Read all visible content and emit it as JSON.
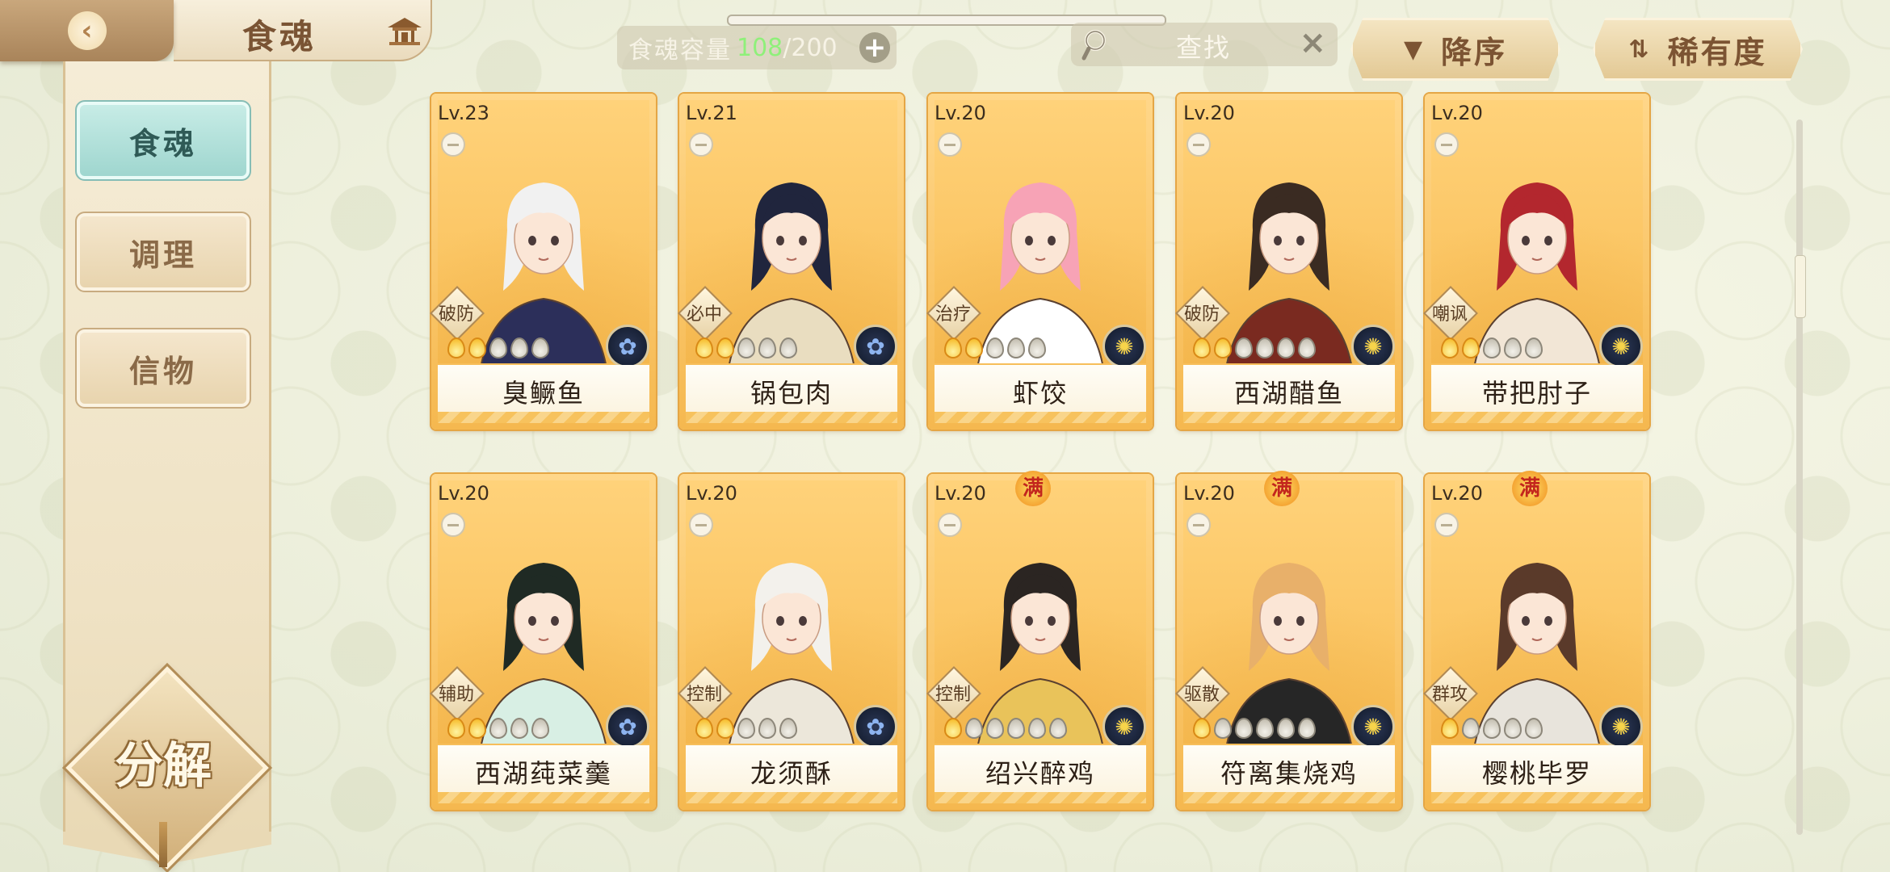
{
  "header": {
    "back_icon": "chevron-left-icon",
    "title": "食魂",
    "home_icon": "pavilion-icon"
  },
  "capacity": {
    "label": "食魂容量",
    "current": "108",
    "max": "200"
  },
  "search": {
    "placeholder": "查找",
    "clear": "×"
  },
  "sort": {
    "order_label": "降序",
    "rarity_label": "稀有度"
  },
  "sidebar": {
    "items": [
      {
        "label": "食魂",
        "active": true
      },
      {
        "label": "调理",
        "active": false
      },
      {
        "label": "信物",
        "active": false
      }
    ],
    "decompose_label": "分解"
  },
  "cards": [
    {
      "level": "Lv.23",
      "role": "破防",
      "name": "臭鳜鱼",
      "stars_on": 2,
      "stars_total": 5,
      "element": "flower",
      "full": ""
    },
    {
      "level": "Lv.21",
      "role": "必中",
      "name": "锅包肉",
      "stars_on": 2,
      "stars_total": 5,
      "element": "flower",
      "full": ""
    },
    {
      "level": "Lv.20",
      "role": "治疗",
      "name": "虾饺",
      "stars_on": 2,
      "stars_total": 5,
      "element": "sun",
      "full": ""
    },
    {
      "level": "Lv.20",
      "role": "破防",
      "name": "西湖醋鱼",
      "stars_on": 2,
      "stars_total": 6,
      "element": "sun",
      "full": ""
    },
    {
      "level": "Lv.20",
      "role": "嘲讽",
      "name": "带把肘子",
      "stars_on": 2,
      "stars_total": 5,
      "element": "sun",
      "full": ""
    },
    {
      "level": "Lv.20",
      "role": "辅助",
      "name": "西湖莼菜羹",
      "stars_on": 2,
      "stars_total": 5,
      "element": "flower",
      "full": ""
    },
    {
      "level": "Lv.20",
      "role": "控制",
      "name": "龙须酥",
      "stars_on": 2,
      "stars_total": 5,
      "element": "flower",
      "full": ""
    },
    {
      "level": "Lv.20",
      "role": "控制",
      "name": "绍兴醉鸡",
      "stars_on": 1,
      "stars_total": 6,
      "element": "sun",
      "full": "满"
    },
    {
      "level": "Lv.20",
      "role": "驱散",
      "name": "符离集烧鸡",
      "stars_on": 1,
      "stars_total": 6,
      "element": "sun",
      "full": "满"
    },
    {
      "level": "Lv.20",
      "role": "群攻",
      "name": "樱桃毕罗",
      "stars_on": 1,
      "stars_total": 5,
      "element": "sun",
      "full": "满"
    }
  ]
}
